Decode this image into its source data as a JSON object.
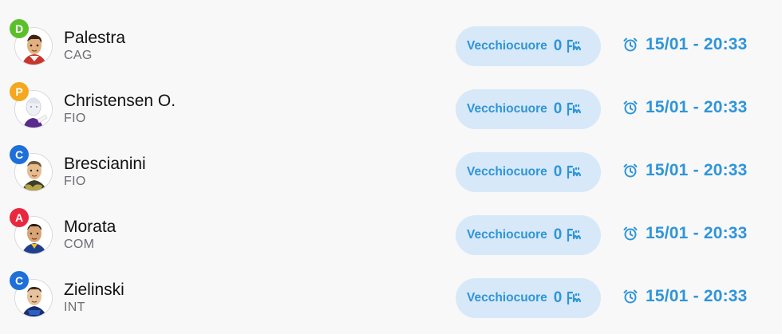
{
  "colors": {
    "accent": "#2f95d8",
    "pill_bg": "#d7e8f8",
    "badge_D": "#5bbf2a",
    "badge_P": "#f4a81d",
    "badge_C": "#1e6fd9",
    "badge_A": "#e8283e"
  },
  "offers": [
    {
      "role": "D",
      "name": "Palestra",
      "team": "CAG",
      "seller": "Vecchiocuore",
      "amount": "0",
      "time": "15/01 - 20:33"
    },
    {
      "role": "P",
      "name": "Christensen O.",
      "team": "FIO",
      "seller": "Vecchiocuore",
      "amount": "0",
      "time": "15/01 - 20:33"
    },
    {
      "role": "C",
      "name": "Brescianini",
      "team": "FIO",
      "seller": "Vecchiocuore",
      "amount": "0",
      "time": "15/01 - 20:33"
    },
    {
      "role": "A",
      "name": "Morata",
      "team": "COM",
      "seller": "Vecchiocuore",
      "amount": "0",
      "time": "15/01 - 20:33"
    },
    {
      "role": "C",
      "name": "Zielinski",
      "team": "INT",
      "seller": "Vecchiocuore",
      "amount": "0",
      "time": "15/01 - 20:33"
    }
  ]
}
